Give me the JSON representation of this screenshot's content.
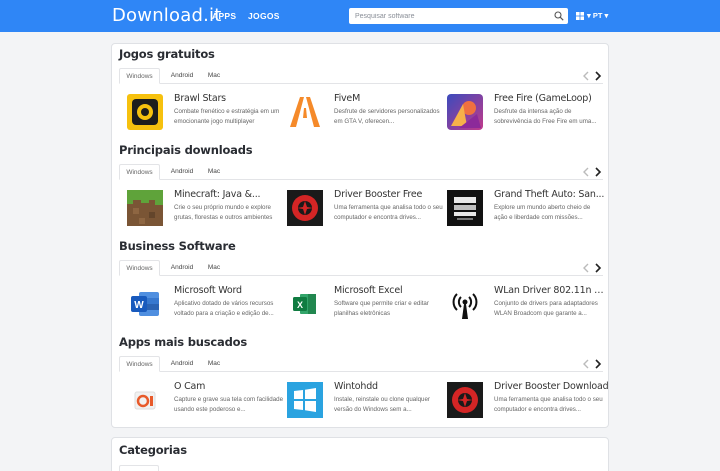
{
  "header": {
    "logo": "Download.it",
    "nav": [
      "APPS",
      "JOGOS"
    ],
    "search_placeholder": "Pesquisar software",
    "language": "PT",
    "brand_color": "#2f86f6"
  },
  "sections": [
    {
      "title": "Jogos gratuitos",
      "tabs": [
        "Windows",
        "Android",
        "Mac"
      ],
      "apps": [
        {
          "name": "Brawl Stars",
          "desc": "Combate frenético e estratégia em um emocionante jogo multiplayer",
          "icon": "brawl-stars-icon"
        },
        {
          "name": "FiveM",
          "desc": "Desfrute de servidores personalizados em GTA V, oferecen...",
          "icon": "fivem-icon"
        },
        {
          "name": "Free Fire (GameLoop)",
          "desc": "Desfrute da intensa ação de sobrevivência do Free Fire em uma...",
          "icon": "free-fire-icon"
        }
      ]
    },
    {
      "title": "Principais downloads",
      "tabs": [
        "Windows",
        "Android",
        "Mac"
      ],
      "apps": [
        {
          "name": "Minecraft: Java &...",
          "desc": "Crie o seu próprio mundo e explore grutas, florestas e outros ambientes",
          "icon": "minecraft-icon"
        },
        {
          "name": "Driver Booster Free",
          "desc": "Uma ferramenta que analisa todo o seu computador e encontra drives...",
          "icon": "driver-booster-icon"
        },
        {
          "name": "Grand Theft Auto: San...",
          "desc": "Explore um mundo aberto cheio de ação e liberdade com missões...",
          "icon": "gta-san-andreas-icon"
        }
      ]
    },
    {
      "title": "Business Software",
      "tabs": [
        "Windows",
        "Android",
        "Mac"
      ],
      "apps": [
        {
          "name": "Microsoft Word",
          "desc": "Aplicativo dotado de vários recursos voltado para a criação e edição de...",
          "icon": "word-icon"
        },
        {
          "name": "Microsoft Excel",
          "desc": "Software que permite criar e editar planilhas eletrônicas",
          "icon": "excel-icon"
        },
        {
          "name": "WLan Driver 802.11n Rel...",
          "desc": "Conjunto de drivers para adaptadores WLAN Broadcom que garante a...",
          "icon": "wlan-antenna-icon"
        }
      ]
    },
    {
      "title": "Apps mais buscados",
      "tabs": [
        "Windows",
        "Android",
        "Mac"
      ],
      "apps": [
        {
          "name": "O Cam",
          "desc": "Capture e grave sua tela com facilidade usando este poderoso e...",
          "icon": "ocam-icon"
        },
        {
          "name": "Wintohdd",
          "desc": "Instale, reinstale ou clone qualquer versão do Windows sem a...",
          "icon": "wintohdd-icon"
        },
        {
          "name": "Driver Booster Download",
          "desc": "Uma ferramenta que analisa todo o seu computador e encontra drives...",
          "icon": "driver-booster-icon"
        }
      ]
    }
  ],
  "categories": {
    "title": "Categorias"
  }
}
